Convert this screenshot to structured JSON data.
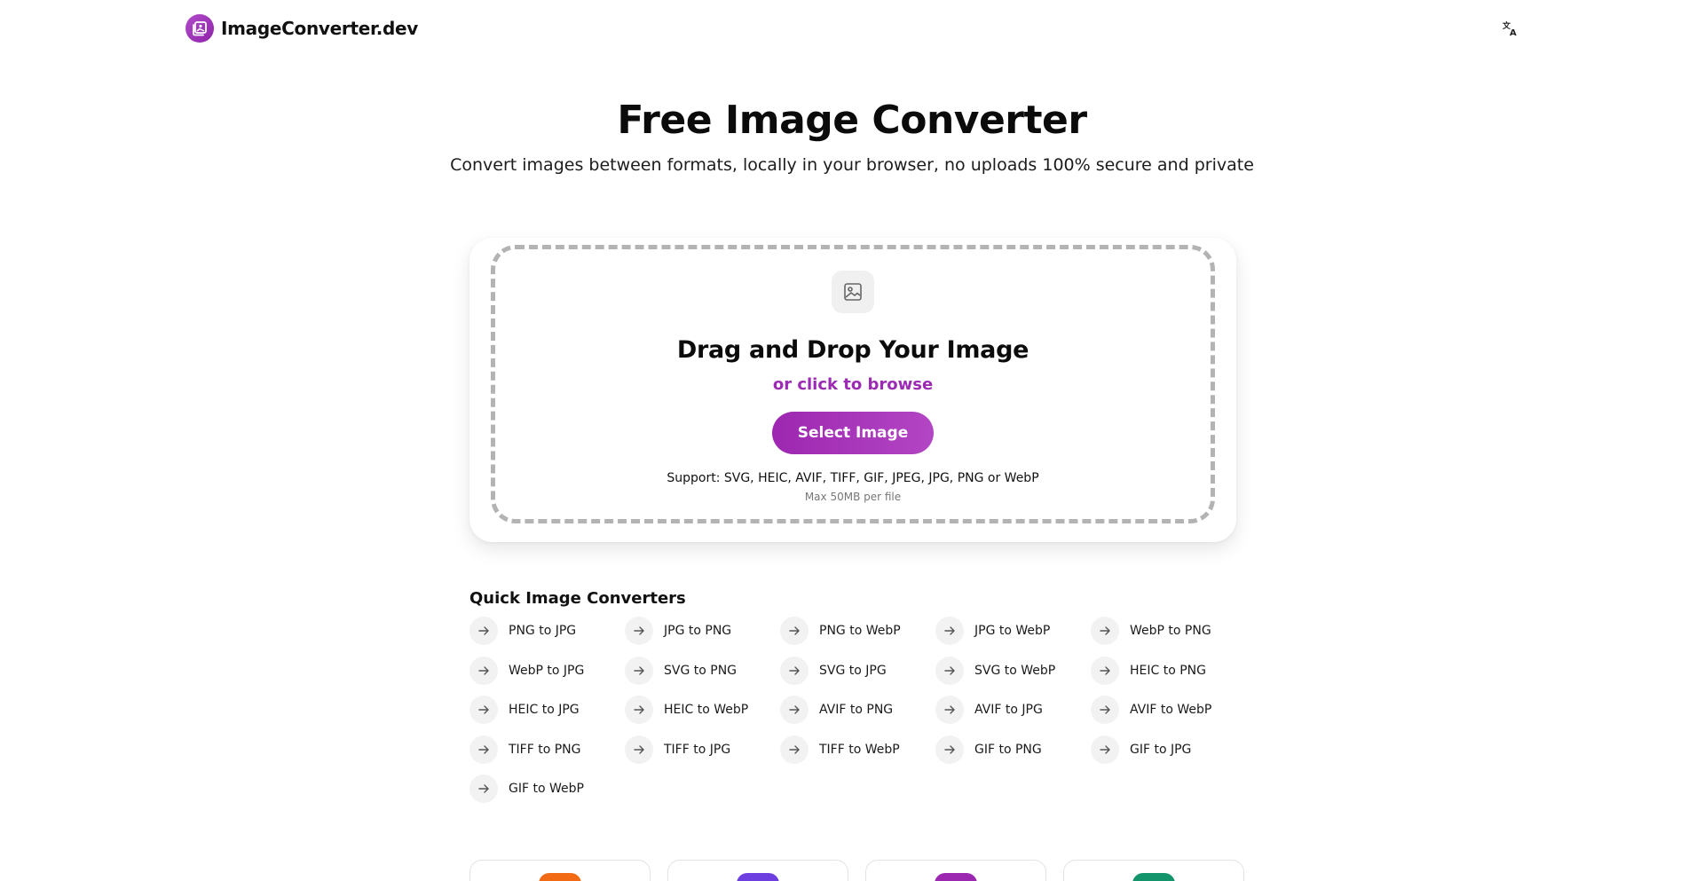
{
  "header": {
    "logo_text": "ImageConverter.dev",
    "logo_icon": "photo-stack-icon",
    "language_icon": "translate-icon"
  },
  "hero": {
    "title": "Free Image Converter",
    "subtitle": "Convert images between formats, locally in your browser, no uploads 100% secure and private"
  },
  "upload": {
    "icon": "image-icon",
    "title": "Drag and Drop Your Image",
    "browse_text": "or click to browse",
    "button_label": "Select Image",
    "support_text": "Support: SVG, HEIC, AVIF, TIFF, GIF, JPEG, JPG, PNG or WebP",
    "max_text": "Max 50MB per file"
  },
  "quick": {
    "title": "Quick Image Converters",
    "items": [
      "PNG to JPG",
      "JPG to PNG",
      "PNG to WebP",
      "JPG to WebP",
      "WebP to PNG",
      "WebP to JPG",
      "SVG to PNG",
      "SVG to JPG",
      "SVG to WebP",
      "HEIC to PNG",
      "HEIC to JPG",
      "HEIC to WebP",
      "AVIF to PNG",
      "AVIF to JPG",
      "AVIF to WebP",
      "TIFF to PNG",
      "TIFF to JPG",
      "TIFF to WebP",
      "GIF to PNG",
      "GIF to JPG",
      "GIF to WebP"
    ]
  },
  "features": [
    {
      "icon": "feature-icon",
      "color": "#f26a14"
    },
    {
      "icon": "feature-icon",
      "color": "#6e3fe0"
    },
    {
      "icon": "feature-icon",
      "color": "#9c27b0"
    },
    {
      "icon": "feature-icon",
      "color": "#13946b"
    }
  ],
  "colors": {
    "accent": "#9c2bb3",
    "text": "#111111",
    "muted": "#777777"
  }
}
